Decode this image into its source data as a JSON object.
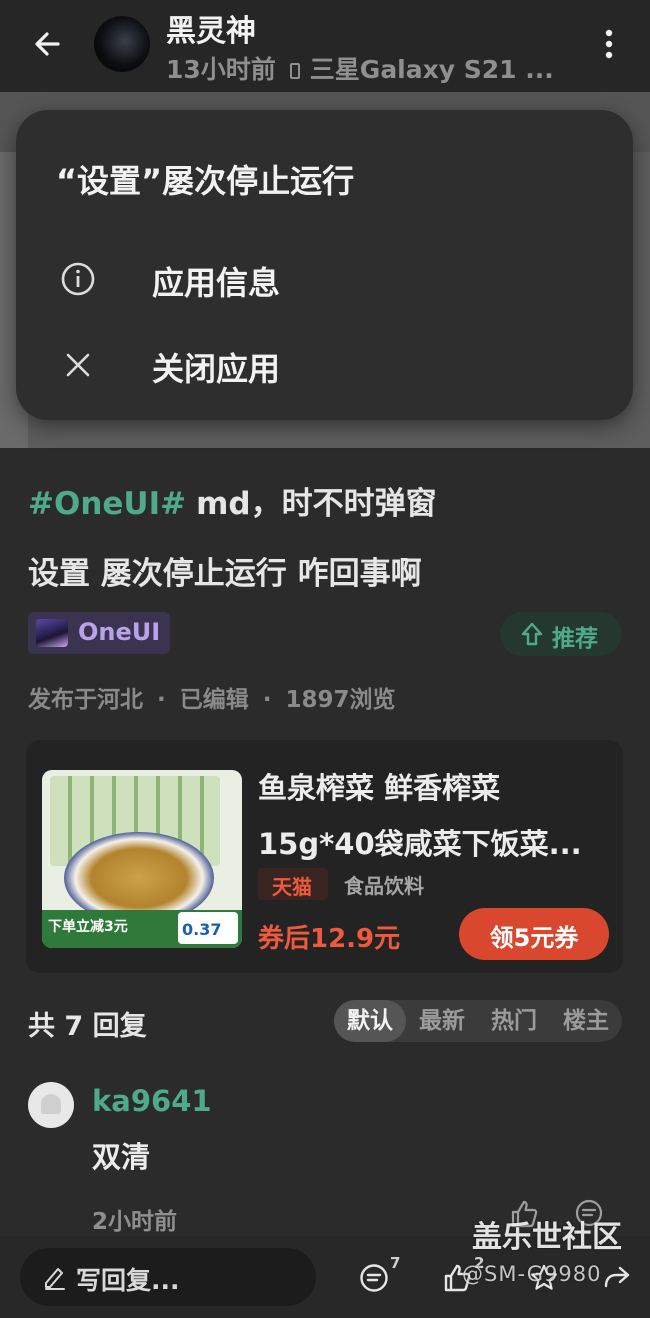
{
  "header": {
    "author": "黑灵神",
    "time_ago": "13小时前",
    "device": "三星Galaxy S21 ..."
  },
  "dialog": {
    "title": "“设置”屡次停止运行",
    "options": [
      {
        "label": "应用信息",
        "icon": "info-icon"
      },
      {
        "label": "关闭应用",
        "icon": "close-icon"
      }
    ]
  },
  "post": {
    "hashtag": "#OneUI#",
    "line1_rest": "md，时不时弹窗",
    "line2": "设置 屡次停止运行 咋回事啊",
    "topic": "OneUI",
    "recommend_label": "推荐",
    "location": "发布于河北",
    "edited": "已编辑",
    "views": "1897浏览"
  },
  "product": {
    "title_line1": "鱼泉榨菜 鲜香榨菜",
    "title_line2": "15g*40袋咸菜下饭菜...",
    "store_badge": "天猫",
    "category": "食品饮料",
    "coupon_price": "券后12.9元",
    "coupon_button": "领5元券",
    "image_band_text": "下单立减3元",
    "image_price_text": "0.37"
  },
  "replies": {
    "count_label": "共 7 回复",
    "sort_options": [
      "默认",
      "最新",
      "热门",
      "楼主"
    ],
    "sort_selected": "默认",
    "items": [
      {
        "user": "ka9641",
        "text": "双清",
        "time": "2小时前"
      }
    ]
  },
  "bottom_bar": {
    "write_placeholder": "写回复...",
    "comment_count": "7",
    "like_count": "2"
  },
  "watermark": {
    "site": "盖乐世社区",
    "handle": "@SM-G9980"
  },
  "colors": {
    "accent_green": "#4faa8c",
    "coupon_red": "#d9472e",
    "topic_purple": "#b9a2ea"
  }
}
